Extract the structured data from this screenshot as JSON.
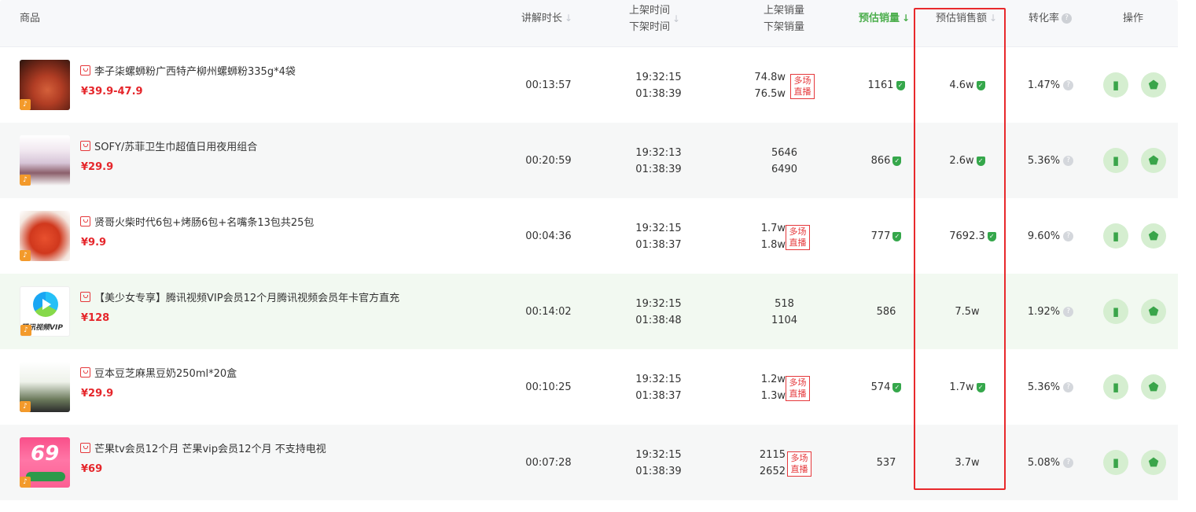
{
  "header": {
    "product": "商品",
    "duration": "讲解时长",
    "shelf_on": "上架时间",
    "shelf_off": "下架时间",
    "vol_on": "上架销量",
    "vol_off": "下架销量",
    "est_sales": "预估销量",
    "est_amount": "预估销售额",
    "conversion": "转化率",
    "actions": "操作",
    "sort_arrow": "↓",
    "help_icon": "?"
  },
  "rows": [
    {
      "name": "李子柒螺蛳粉广西特产柳州螺蛳粉335g*4袋",
      "price": "¥39.9-47.9",
      "duration": "00:13:57",
      "time_on": "19:32:15",
      "time_off": "01:38:39",
      "vol_on": "74.8w",
      "vol_off": "76.5w",
      "multi_tag": "多场直播",
      "est_sales": "1161",
      "est_amount": "4.6w",
      "conversion": "1.47%"
    },
    {
      "name": "SOFY/苏菲卫生巾超值日用夜用组合",
      "price": "¥29.9",
      "duration": "00:20:59",
      "time_on": "19:32:13",
      "time_off": "01:38:39",
      "vol_on": "5646",
      "vol_off": "6490",
      "multi_tag": "",
      "est_sales": "866",
      "est_amount": "2.6w",
      "conversion": "5.36%"
    },
    {
      "name": "贤哥火柴时代6包+烤肠6包+名嘴条13包共25包",
      "price": "¥9.9",
      "duration": "00:04:36",
      "time_on": "19:32:15",
      "time_off": "01:38:37",
      "vol_on": "1.7w",
      "vol_off": "1.8w",
      "multi_tag": "多场直播",
      "est_sales": "777",
      "est_amount": "7692.3",
      "conversion": "9.60%"
    },
    {
      "name": "【美少女专享】腾讯视频VIP会员12个月腾讯视频会员年卡官方直充",
      "price": "¥128",
      "duration": "00:14:02",
      "time_on": "19:32:15",
      "time_off": "01:38:48",
      "vol_on": "518",
      "vol_off": "1104",
      "multi_tag": "",
      "est_sales": "586",
      "est_amount": "7.5w",
      "conversion": "1.92%",
      "thumb_text": "腾讯视频VIP"
    },
    {
      "name": "豆本豆芝麻黑豆奶250ml*20盒",
      "price": "¥29.9",
      "duration": "00:10:25",
      "time_on": "19:32:15",
      "time_off": "01:38:37",
      "vol_on": "1.2w",
      "vol_off": "1.3w",
      "multi_tag": "多场直播",
      "est_sales": "574",
      "est_amount": "1.7w",
      "conversion": "5.36%"
    },
    {
      "name": "芒果tv会员12个月 芒果vip会员12个月 不支持电视",
      "price": "¥69",
      "duration": "00:07:28",
      "time_on": "19:32:15",
      "time_off": "01:38:39",
      "vol_on": "2115",
      "vol_off": "2652",
      "multi_tag": "多场直播",
      "est_sales": "537",
      "est_amount": "3.7w",
      "conversion": "5.08%",
      "thumb_text": "69"
    }
  ],
  "icons": {
    "verified": "shield-check-icon",
    "help": "question-circle-icon",
    "chart": "bar-chart-icon",
    "bag": "shopping-bag-icon",
    "goods": "goods-tag-icon"
  },
  "colors": {
    "accent_green": "#4cae4c",
    "price_red": "#e5262b",
    "highlight_red": "#e8292c"
  }
}
